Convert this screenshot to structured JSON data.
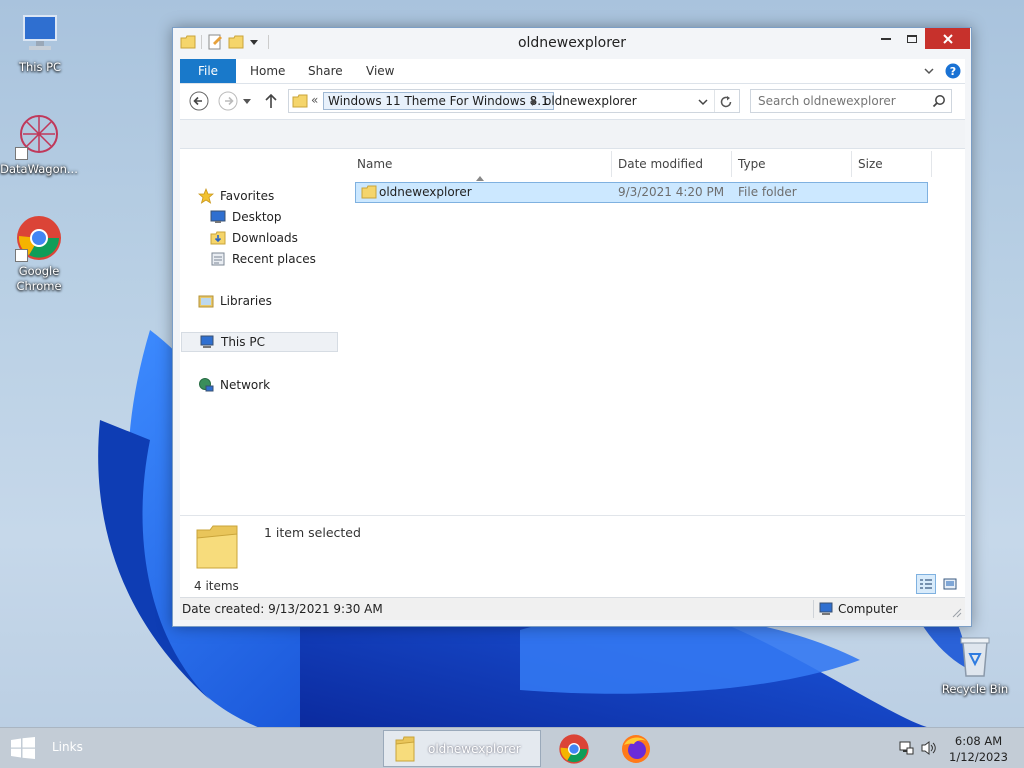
{
  "desktop": {
    "icons": [
      {
        "label": "This PC"
      },
      {
        "label": "DataWagon..."
      },
      {
        "label": "Google Chrome"
      },
      {
        "label": "Recycle Bin"
      }
    ]
  },
  "window": {
    "title": "oldnewexplorer",
    "ribbon_tabs": [
      "File",
      "Home",
      "Share",
      "View"
    ],
    "address": {
      "overflow": "«",
      "breadcrumb_parent": "Windows 11 Theme For Windows 8.1",
      "breadcrumb_current": "oldnewexplorer"
    },
    "search_placeholder": "Search oldnewexplorer",
    "nav": {
      "favorites": "Favorites",
      "desktop": "Desktop",
      "downloads": "Downloads",
      "recent": "Recent places",
      "libraries": "Libraries",
      "this_pc": "This PC",
      "network": "Network"
    },
    "columns": [
      "Name",
      "Date modified",
      "Type",
      "Size"
    ],
    "files": [
      {
        "name": "oldnewexplorer",
        "date": "9/3/2021 4:20 PM",
        "type": "File folder",
        "size": ""
      }
    ],
    "details": {
      "selected": "1 item selected",
      "count": "4 items"
    },
    "status": {
      "date_created": "Date created: 9/13/2021 9:30 AM",
      "location": "Computer"
    }
  },
  "taskbar": {
    "links": "Links",
    "task_label": "oldnewexplorer",
    "time": "6:08 AM",
    "date": "1/12/2023"
  },
  "colors": {
    "accent": "#1979ca",
    "close": "#c7312c",
    "selection": "#cce8ff",
    "folder": "#f5d56b"
  }
}
